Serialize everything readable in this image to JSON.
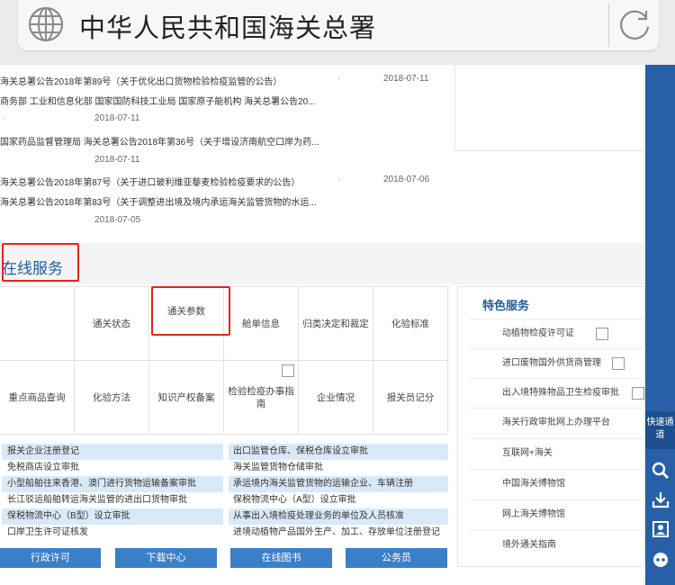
{
  "address_bar": {
    "title": "中华人民共和国海关总署"
  },
  "news": [
    {
      "text": "海关总署公告2018年第89号（关于优化出口货物检验检疫监管的公告）",
      "date": "2018-07-11",
      "dot": "·"
    },
    {
      "text": "商务部 工业和信息化部 国家国防科技工业局 国家原子能机构 海关总署公告20...",
      "date": "2018-07-11",
      "dot": "·"
    },
    {
      "text": "国家药品监督管理局 海关总署公告2018年第36号（关于增设济南航空口岸为药...",
      "date": "2018-07-11",
      "dot": ""
    },
    {
      "text": "海关总署公告2018年第87号（关于进口玻利维亚藜麦检验检疫要求的公告）",
      "date": "2018-07-06",
      "dot": "·"
    },
    {
      "text": "海关总署公告2018年第83号（关于调整进出境及境内承运海关监管货物的水运...",
      "date": "2018-07-05",
      "dot": ""
    }
  ],
  "online_services": {
    "title": "在线服务",
    "row1": [
      "",
      "通关状态",
      "通关参数",
      "舱单信息",
      "归类决定和裁定",
      "化验标准"
    ],
    "row2": [
      "重点商品查询",
      "化验方法",
      "知识产权备案",
      "检验检疫办事指南",
      "企业情况",
      "报关员记分"
    ]
  },
  "feature_services": {
    "title": "特色服务",
    "items": [
      "动植物检疫许可证",
      "进口废物国外供货商管理",
      "出入境特殊物品卫生检疫审批",
      "海关行政审批网上办理平台",
      "互联网+海关",
      "中国海关博物馆",
      "网上海关博物馆",
      "境外通关指南"
    ]
  },
  "approvals": {
    "left": [
      "报关企业注册登记",
      "免税商店设立审批",
      "小型船舶往来香港、澳门进行货物运输备案审批",
      "长江驳运船舶转运海关监管的进出口货物审批",
      "保税物流中心（B型）设立审批",
      "口岸卫生许可证核发"
    ],
    "right": [
      "出口监管仓库、保税仓库设立审批",
      "海关监管货物仓储审批",
      "承运境内海关监管货物的运输企业、车辆注册",
      "保税物流中心（A型）设立审批",
      "从事出入境检疫处理业务的单位及人员核准",
      "进境动植物产品国外生产、加工、存放单位注册登记"
    ]
  },
  "bottom_buttons": [
    "行政许可",
    "下载中心",
    "在线图书",
    "公务员"
  ],
  "right_bar": {
    "quick_label": "快速通道"
  },
  "colors": {
    "brand_blue": "#2760a6",
    "highlight_red": "#e0261b",
    "row_shade": "#d9e9f8"
  }
}
